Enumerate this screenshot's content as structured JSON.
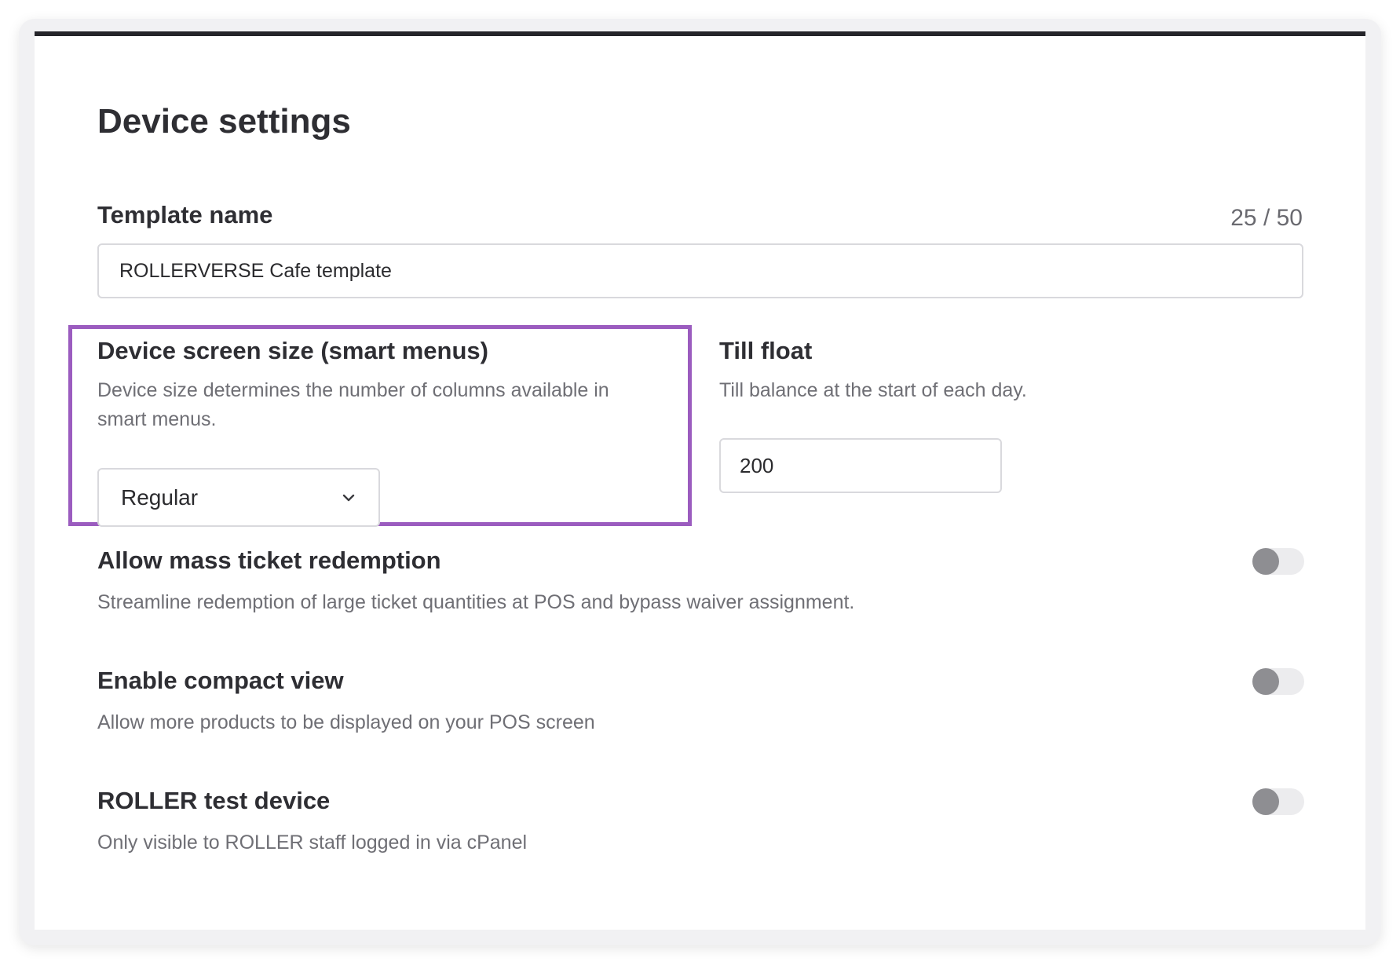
{
  "page": {
    "title": "Device settings"
  },
  "template_name": {
    "label": "Template name",
    "counter": "25 / 50",
    "value": "ROLLERVERSE Cafe template"
  },
  "screen_size": {
    "label": "Device screen size (smart menus)",
    "description": "Device size determines the number of columns available in smart menus.",
    "selected": "Regular"
  },
  "till_float": {
    "label": "Till float",
    "description": "Till balance at the start of each day.",
    "value": "200"
  },
  "toggles": [
    {
      "label": "Allow mass ticket redemption",
      "description": "Streamline redemption of large ticket quantities at POS and bypass waiver assignment.",
      "enabled": false
    },
    {
      "label": "Enable compact view",
      "description": "Allow more products to be displayed on your POS screen",
      "enabled": false
    },
    {
      "label": "ROLLER test device",
      "description": "Only visible to ROLLER staff logged in via cPanel",
      "enabled": false
    }
  ],
  "colors": {
    "highlight": "#9b5cbf",
    "top_border": "#25252a",
    "toggle_off_knob": "#8e8e92"
  },
  "icons": {
    "select_arrow": "chevron-down-icon"
  }
}
